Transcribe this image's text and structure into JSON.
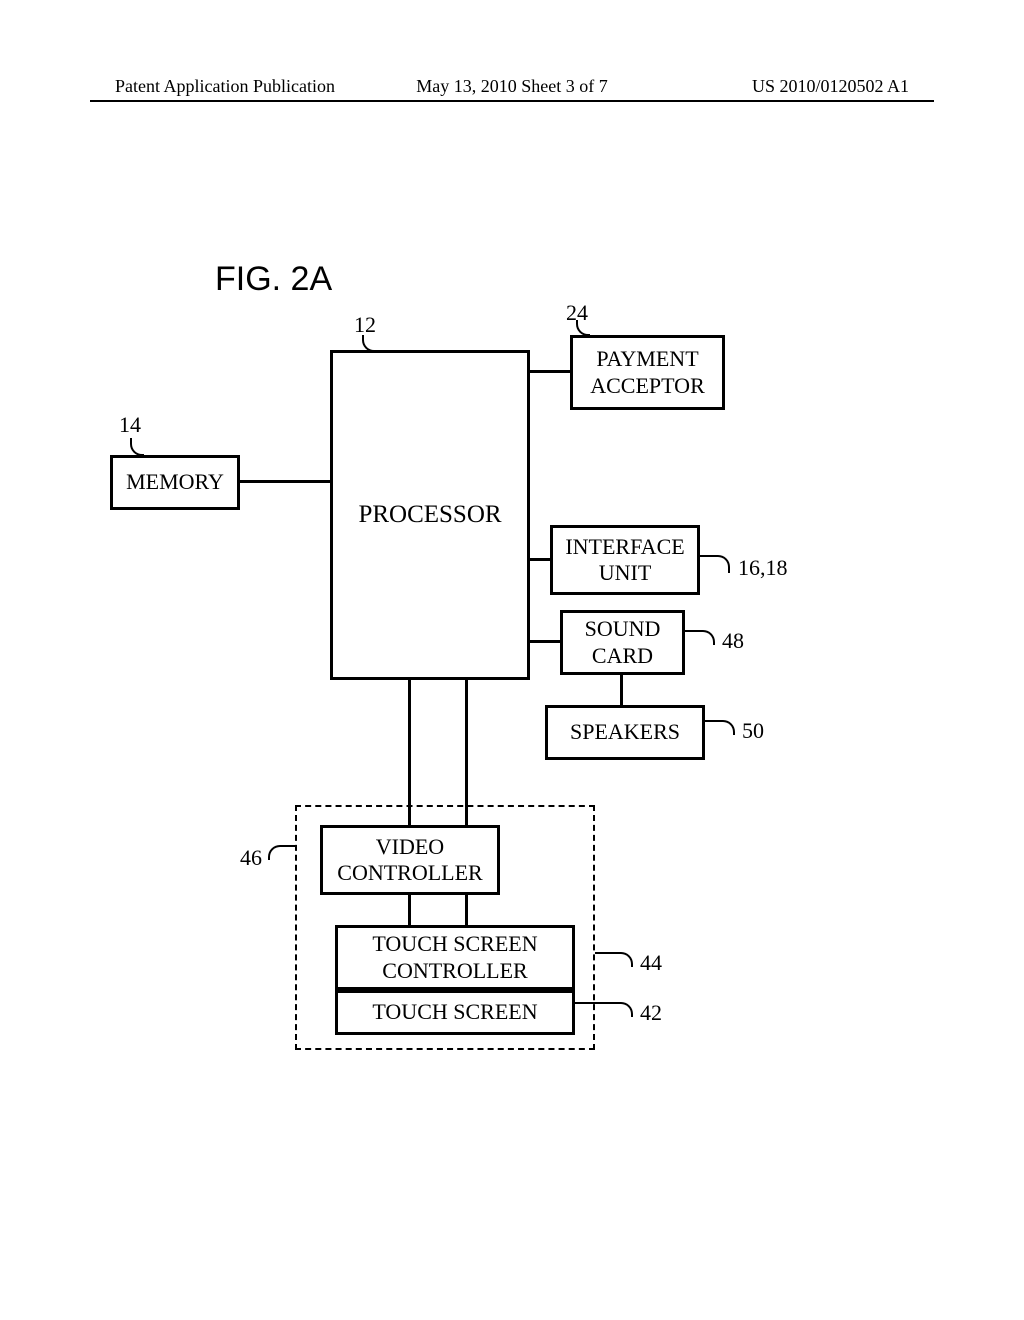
{
  "header": {
    "left": "Patent Application Publication",
    "center": "May 13, 2010  Sheet 3 of 7",
    "right": "US 2010/0120502 A1"
  },
  "figure_label": "FIG. 2A",
  "blocks": {
    "processor": "PROCESSOR",
    "payment": "PAYMENT\nACCEPTOR",
    "memory": "MEMORY",
    "interface": "INTERFACE\nUNIT",
    "sound": "SOUND\nCARD",
    "speakers": "SPEAKERS",
    "video": "VIDEO\nCONTROLLER",
    "touch_controller": "TOUCH SCREEN\nCONTROLLER",
    "touch_screen": "TOUCH SCREEN"
  },
  "refs": {
    "processor": "12",
    "memory": "14",
    "payment": "24",
    "interface": "16,18",
    "sound": "48",
    "speakers": "50",
    "video": "46",
    "touch_controller": "44",
    "touch_screen": "42"
  }
}
